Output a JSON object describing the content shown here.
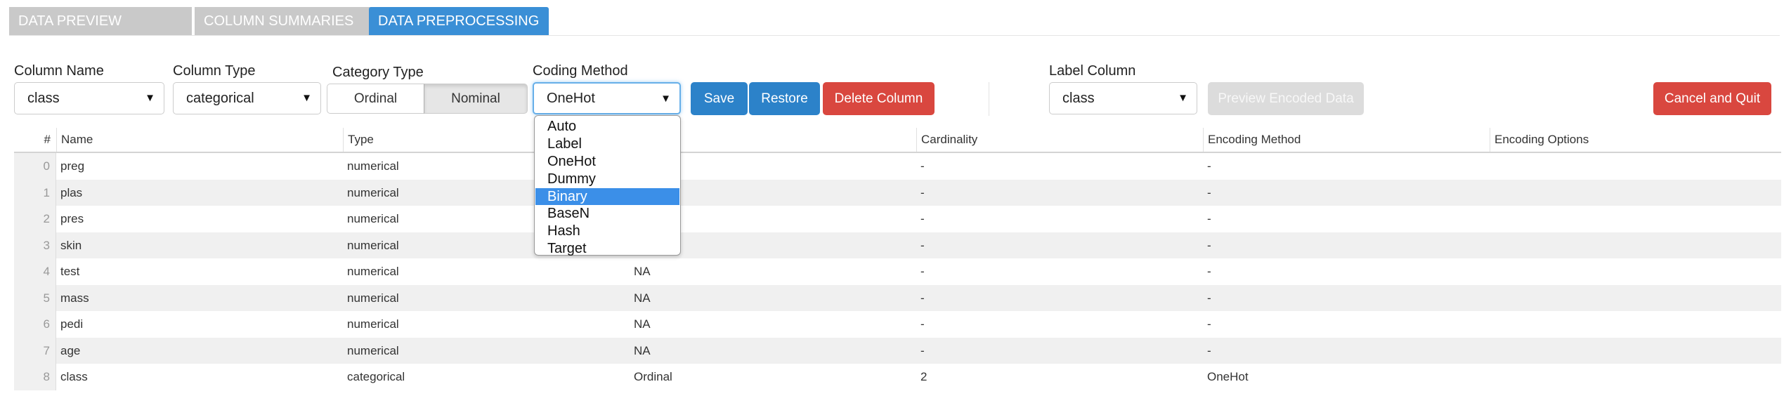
{
  "tabs": [
    {
      "label": "DATA PREVIEW"
    },
    {
      "label": "COLUMN SUMMARIES"
    },
    {
      "label": "DATA PREPROCESSING"
    }
  ],
  "controls": {
    "column_name": {
      "label": "Column Name",
      "value": "class"
    },
    "column_type": {
      "label": "Column Type",
      "value": "categorical"
    },
    "category_type": {
      "label": "Category Type",
      "options": [
        "Ordinal",
        "Nominal"
      ],
      "selected": "Nominal"
    },
    "coding_method": {
      "label": "Coding Method",
      "value": "OneHot",
      "options": [
        "Auto",
        "Label",
        "OneHot",
        "Dummy",
        "Binary",
        "BaseN",
        "Hash",
        "Target"
      ],
      "highlighted": "Binary"
    },
    "save_label": "Save",
    "restore_label": "Restore",
    "delete_label": "Delete Column",
    "label_column": {
      "label": "Label Column",
      "value": "class"
    },
    "preview_label": "Preview Encoded Data",
    "cancel_label": "Cancel and Quit"
  },
  "icons": {
    "dropdown_arrow": "▼"
  },
  "table": {
    "headers": [
      "#",
      "Name",
      "Type",
      "",
      "Cardinality",
      "Encoding Method",
      "Encoding Options"
    ],
    "rows": [
      [
        "0",
        "preg",
        "numerical",
        "",
        "-",
        "-",
        ""
      ],
      [
        "1",
        "plas",
        "numerical",
        "",
        "-",
        "-",
        ""
      ],
      [
        "2",
        "pres",
        "numerical",
        "",
        "-",
        "-",
        ""
      ],
      [
        "3",
        "skin",
        "numerical",
        "",
        "-",
        "-",
        ""
      ],
      [
        "4",
        "test",
        "numerical",
        "NA",
        "-",
        "-",
        ""
      ],
      [
        "5",
        "mass",
        "numerical",
        "NA",
        "-",
        "-",
        ""
      ],
      [
        "6",
        "pedi",
        "numerical",
        "NA",
        "-",
        "-",
        ""
      ],
      [
        "7",
        "age",
        "numerical",
        "NA",
        "-",
        "-",
        ""
      ],
      [
        "8",
        "class",
        "categorical",
        "Ordinal",
        "2",
        "OneHot",
        ""
      ]
    ]
  },
  "colors": {
    "tab_active": "#3a8fd6",
    "tab_inactive": "#c9c9c9",
    "button_blue": "#2c82c9",
    "button_red": "#d9473f",
    "button_disabled": "#dcdcdc",
    "dropdown_highlight": "#3b8fe8"
  }
}
